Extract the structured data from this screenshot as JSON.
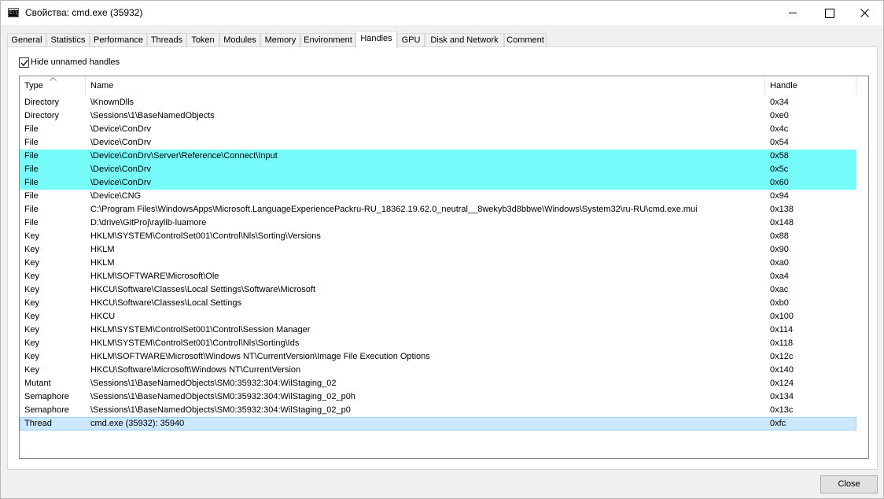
{
  "window": {
    "title": "Свойства: cmd.exe (35932)",
    "icon_text": "C:\\_"
  },
  "tabs": [
    {
      "label": "General"
    },
    {
      "label": "Statistics"
    },
    {
      "label": "Performance"
    },
    {
      "label": "Threads"
    },
    {
      "label": "Token"
    },
    {
      "label": "Modules"
    },
    {
      "label": "Memory"
    },
    {
      "label": "Environment"
    },
    {
      "label": "Handles",
      "active": true
    },
    {
      "label": "GPU"
    },
    {
      "label": "Disk and Network"
    },
    {
      "label": "Comment"
    }
  ],
  "handles": {
    "hide_unnamed_label": "Hide unnamed handles",
    "hide_unnamed_checked": true,
    "columns": {
      "type": "Type",
      "name": "Name",
      "handle": "Handle"
    },
    "rows": [
      {
        "type": "Directory",
        "name": "\\KnownDlls",
        "handle": "0x34",
        "state": ""
      },
      {
        "type": "Directory",
        "name": "\\Sessions\\1\\BaseNamedObjects",
        "handle": "0xe0",
        "state": ""
      },
      {
        "type": "File",
        "name": "\\Device\\ConDrv",
        "handle": "0x4c",
        "state": ""
      },
      {
        "type": "File",
        "name": "\\Device\\ConDrv",
        "handle": "0x54",
        "state": ""
      },
      {
        "type": "File",
        "name": "\\Device\\ConDrv\\Server\\Reference\\Connect\\Input",
        "handle": "0x58",
        "state": "highlight"
      },
      {
        "type": "File",
        "name": "\\Device\\ConDrv",
        "handle": "0x5c",
        "state": "highlight"
      },
      {
        "type": "File",
        "name": "\\Device\\ConDrv",
        "handle": "0x60",
        "state": "highlight"
      },
      {
        "type": "File",
        "name": "\\Device\\CNG",
        "handle": "0x94",
        "state": ""
      },
      {
        "type": "File",
        "name": "C:\\Program Files\\WindowsApps\\Microsoft.LanguageExperiencePackru-RU_18362.19.62.0_neutral__8wekyb3d8bbwe\\Windows\\System32\\ru-RU\\cmd.exe.mui",
        "handle": "0x138",
        "state": ""
      },
      {
        "type": "File",
        "name": "D:\\drive\\GitProj\\raylib-luamore",
        "handle": "0x148",
        "state": ""
      },
      {
        "type": "Key",
        "name": "HKLM\\SYSTEM\\ControlSet001\\Control\\Nls\\Sorting\\Versions",
        "handle": "0x88",
        "state": ""
      },
      {
        "type": "Key",
        "name": "HKLM",
        "handle": "0x90",
        "state": ""
      },
      {
        "type": "Key",
        "name": "HKLM",
        "handle": "0xa0",
        "state": ""
      },
      {
        "type": "Key",
        "name": "HKLM\\SOFTWARE\\Microsoft\\Ole",
        "handle": "0xa4",
        "state": ""
      },
      {
        "type": "Key",
        "name": "HKCU\\Software\\Classes\\Local Settings\\Software\\Microsoft",
        "handle": "0xac",
        "state": ""
      },
      {
        "type": "Key",
        "name": "HKCU\\Software\\Classes\\Local Settings",
        "handle": "0xb0",
        "state": ""
      },
      {
        "type": "Key",
        "name": "HKCU",
        "handle": "0x100",
        "state": ""
      },
      {
        "type": "Key",
        "name": "HKLM\\SYSTEM\\ControlSet001\\Control\\Session Manager",
        "handle": "0x114",
        "state": ""
      },
      {
        "type": "Key",
        "name": "HKLM\\SYSTEM\\ControlSet001\\Control\\Nls\\Sorting\\Ids",
        "handle": "0x118",
        "state": ""
      },
      {
        "type": "Key",
        "name": "HKLM\\SOFTWARE\\Microsoft\\Windows NT\\CurrentVersion\\Image File Execution Options",
        "handle": "0x12c",
        "state": ""
      },
      {
        "type": "Key",
        "name": "HKCU\\Software\\Microsoft\\Windows NT\\CurrentVersion",
        "handle": "0x140",
        "state": ""
      },
      {
        "type": "Mutant",
        "name": "\\Sessions\\1\\BaseNamedObjects\\SM0:35932:304:WilStaging_02",
        "handle": "0x124",
        "state": ""
      },
      {
        "type": "Semaphore",
        "name": "\\Sessions\\1\\BaseNamedObjects\\SM0:35932:304:WilStaging_02_p0h",
        "handle": "0x134",
        "state": ""
      },
      {
        "type": "Semaphore",
        "name": "\\Sessions\\1\\BaseNamedObjects\\SM0:35932:304:WilStaging_02_p0",
        "handle": "0x13c",
        "state": ""
      },
      {
        "type": "Thread",
        "name": "cmd.exe (35932): 35940",
        "handle": "0xfc",
        "state": "selected"
      }
    ]
  },
  "footer": {
    "close_label": "Close"
  },
  "colors": {
    "highlight": "#77fcfc",
    "selected": "#cce8ff"
  },
  "icons": [
    "console-app-icon",
    "minimize-icon",
    "maximize-icon",
    "close-icon",
    "checkmark-icon",
    "sort-ascending-icon"
  ]
}
